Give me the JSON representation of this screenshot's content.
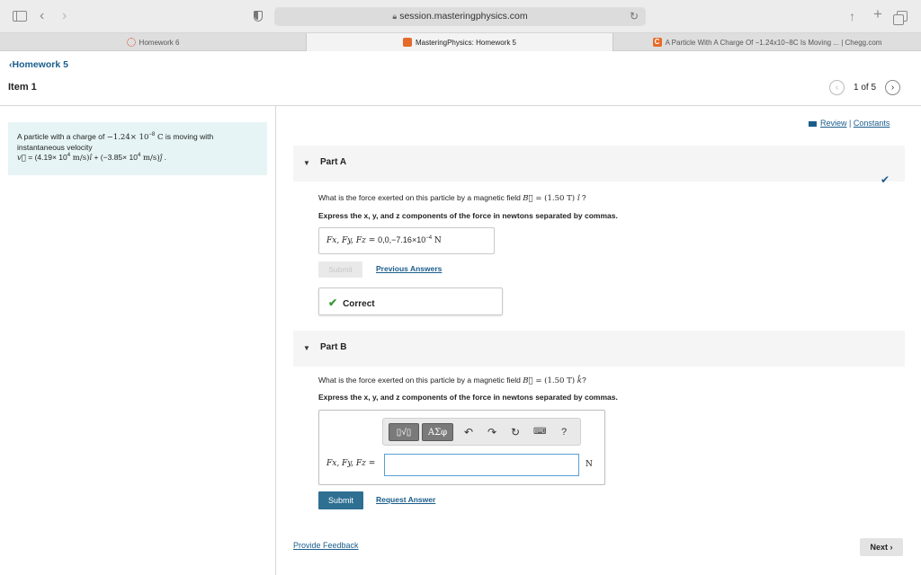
{
  "browser": {
    "url": "session.masteringphysics.com",
    "tabs": [
      {
        "label": "Homework 6"
      },
      {
        "label": "MasteringPhysics: Homework 5"
      },
      {
        "label": "A Particle With A Charge Of −1.24x10−8C Is Moving ... | Chegg.com"
      }
    ]
  },
  "header": {
    "breadcrumb": "Homework 5",
    "item_title": "Item 1",
    "pager_text": "1 of 5"
  },
  "problem": {
    "line1_pre": "A particle with a charge of ",
    "charge_mantissa": "−1.24× 10",
    "charge_exp": "−8",
    "charge_unit": " C",
    "line1_post": " is moving with",
    "line2": "instantaneous velocity",
    "v_symbol": "v⃗",
    "v_eq": " = (4.19× 10",
    "v_exp1": "4",
    "v_unit1": " m/s)",
    "v_ihat": "î",
    "v_plus": " + (−3.85× 10",
    "v_exp2": "4",
    "v_unit2": " m/s)",
    "v_jhat": "ĵ",
    "v_end": " ."
  },
  "links": {
    "review": "Review",
    "separator": " | ",
    "constants": "Constants",
    "previous_answers": "Previous Answers",
    "request_answer": "Request Answer",
    "provide_feedback": "Provide Feedback"
  },
  "part_a": {
    "title": "Part A",
    "question_pre": "What is the force exerted on this particle by a magnetic field ",
    "field": "B⃗",
    "question_val": " = (1.50 T) ",
    "unit_vec": "î",
    "question_end": " ?",
    "instruction": "Express the x, y, and z components of the force in newtons separated by commas.",
    "answer_label": "Fx, Fy, Fz = ",
    "answer_value": "0,0,−7.16×10",
    "answer_exp": "−4",
    "answer_unit": " N",
    "submit_label": "Submit",
    "status": "Correct"
  },
  "part_b": {
    "title": "Part B",
    "question_pre": "What is the force exerted on this particle by a magnetic field ",
    "field": "B⃗",
    "question_val": " = (1.50 T) ",
    "unit_vec": "k̂",
    "question_end": "?",
    "instruction": "Express the x, y, and z components of the force in newtons separated by commas.",
    "input_label": "Fx, Fy, Fz = ",
    "input_value": "",
    "unit": "N",
    "toolbar": {
      "template_btn": "▯√▯",
      "symbols_btn": "ΑΣφ",
      "help": "?"
    },
    "submit_label": "Submit"
  },
  "footer": {
    "next_label": "Next"
  }
}
